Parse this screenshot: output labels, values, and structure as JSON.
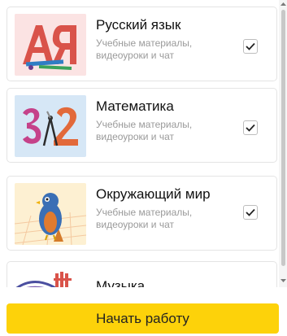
{
  "subjects": [
    {
      "title": "Русский язык",
      "subtitle": "Учебные материалы, видеоуроки и чат",
      "checked": true,
      "icon": "russian-language-icon"
    },
    {
      "title": "Математика",
      "subtitle": "Учебные материалы, видеоуроки и чат",
      "checked": true,
      "icon": "math-icon"
    },
    {
      "title": "Окружающий мир",
      "subtitle": "Учебные материалы, видеоуроки и чат",
      "checked": true,
      "icon": "world-around-icon"
    },
    {
      "title": "Музыка",
      "icon": "music-icon"
    }
  ],
  "actions": {
    "start_label": "Начать работу"
  },
  "colors": {
    "accent": "#fdd20a",
    "check": "#222222",
    "border": "#e4e4e4",
    "subtitle": "#9a9a9a"
  }
}
